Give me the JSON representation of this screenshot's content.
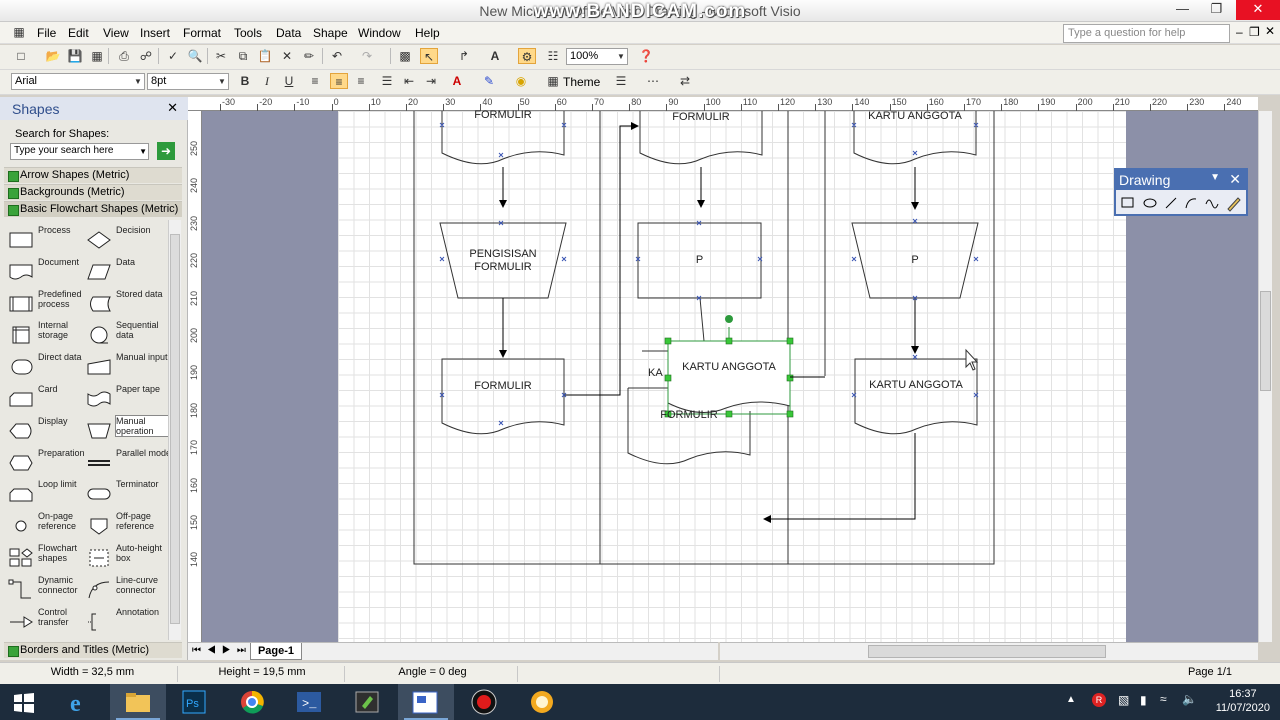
{
  "window": {
    "title": "New Microsoft Office Visio Drawing - Microsoft Visio",
    "watermark": "www.BANDICAM.com"
  },
  "menu": [
    "File",
    "Edit",
    "View",
    "Insert",
    "Format",
    "Tools",
    "Data",
    "Shape",
    "Window",
    "Help"
  ],
  "help_placeholder": "Type a question for help",
  "toolbar": {
    "zoom": "100%",
    "font": "Arial",
    "size": "8pt",
    "theme": "Theme"
  },
  "shapes_panel": {
    "title": "Shapes",
    "search_label": "Search for Shapes:",
    "search_placeholder": "Type your search here",
    "stencils_top": [
      "Arrow Shapes (Metric)",
      "Backgrounds (Metric)",
      "Basic Flowchart Shapes (Metric)"
    ],
    "stencil_bottom": "Borders and Titles (Metric)",
    "items": [
      [
        "Process",
        "Decision"
      ],
      [
        "Document",
        "Data"
      ],
      [
        "Predefined process",
        "Stored data"
      ],
      [
        "Internal storage",
        "Sequential data"
      ],
      [
        "Direct data",
        "Manual input"
      ],
      [
        "Card",
        "Paper tape"
      ],
      [
        "Display",
        "Manual operation"
      ],
      [
        "Preparation",
        "Parallel mode"
      ],
      [
        "Loop limit",
        "Terminator"
      ],
      [
        "On-page reference",
        "Off-page reference"
      ],
      [
        "Flowchart shapes",
        "Auto-height box"
      ],
      [
        "Dynamic connector",
        "Line-curve connector"
      ],
      [
        "Control transfer",
        "Annotation"
      ]
    ]
  },
  "ruler": {
    "top": [
      "-30",
      "-20",
      "-10",
      "0",
      "10",
      "20",
      "30",
      "40",
      "50",
      "60",
      "70",
      "80",
      "90",
      "100",
      "110",
      "120",
      "130",
      "140",
      "150",
      "160",
      "170",
      "180",
      "190",
      "200",
      "210",
      "220",
      "230",
      "240"
    ],
    "left": [
      "250",
      "240",
      "230",
      "220",
      "210",
      "200",
      "190",
      "180",
      "170",
      "160",
      "150",
      "140"
    ]
  },
  "diagram": {
    "col1": {
      "top": "FORMULIR",
      "manual": "PENGISISAN FORMULIR",
      "doc": "FORMULIR"
    },
    "col2": {
      "top": "FORMULIR",
      "process": "P",
      "selected": "KARTU ANGGOTA",
      "behind": "FORMULIR",
      "behind_partial": "KA"
    },
    "col3": {
      "top": "KARTU ANGGOTA",
      "manual": "P",
      "doc": "KARTU ANGGOTA"
    }
  },
  "drawing_toolbar": {
    "title": "Drawing"
  },
  "page_tab": "Page-1",
  "status": {
    "width": "Width = 32,5 mm",
    "height": "Height = 19,5 mm",
    "angle": "Angle = 0 deg",
    "page": "Page 1/1"
  },
  "clock": {
    "time": "16:37",
    "date": "11/07/2020"
  }
}
